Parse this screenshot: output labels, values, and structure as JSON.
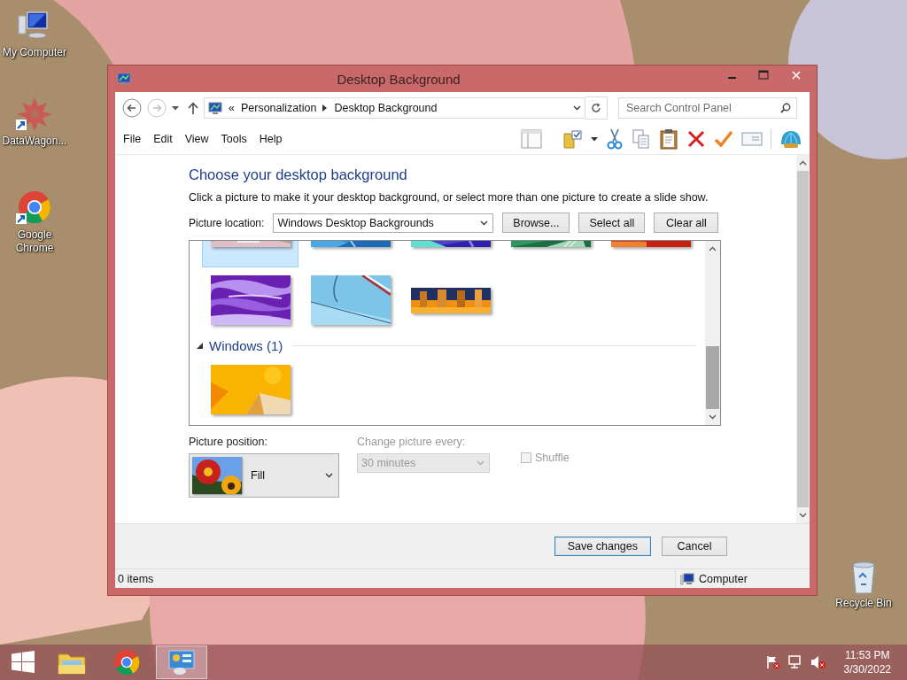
{
  "desktop": {
    "wallpaper": {
      "kind": "picture"
    },
    "icons": [
      {
        "label": "My Computer",
        "kind": "computer",
        "shortcut": false
      },
      {
        "label": "DataWagon...",
        "kind": "datawagon",
        "shortcut": true
      },
      {
        "label": "Google Chrome",
        "kind": "chrome",
        "shortcut": true
      },
      {
        "label": "Recycle Bin",
        "kind": "recycle",
        "shortcut": false
      }
    ]
  },
  "window": {
    "title": "Desktop Background",
    "address_bar": {
      "overflow": "«",
      "path": [
        "Personalization",
        "Desktop Background"
      ]
    },
    "search": {
      "placeholder": "Search Control Panel"
    },
    "menu": [
      "File",
      "Edit",
      "View",
      "Tools",
      "Help"
    ],
    "content": {
      "heading": "Choose your desktop background",
      "description": "Click a picture to make it your desktop background, or select more than one picture to create a slide show.",
      "picture_location": {
        "label": "Picture location:",
        "value": "Windows Desktop Backgrounds"
      },
      "buttons": [
        "Browse...",
        "Select all",
        "Clear all"
      ],
      "gallery": {
        "thumbnails": [
          {
            "kind": "picture",
            "selected": true
          },
          {
            "kind": "picture",
            "selected": false
          },
          {
            "kind": "picture",
            "selected": false
          },
          {
            "kind": "picture",
            "selected": false
          },
          {
            "kind": "picture",
            "selected": false
          },
          {
            "kind": "picture",
            "selected": false
          },
          {
            "kind": "picture",
            "selected": false
          },
          {
            "kind": "picture",
            "selected": false
          }
        ],
        "groups": [
          {
            "label": "Windows (1)",
            "expanded": true,
            "thumbnails": [
              {
                "kind": "picture",
                "selected": false
              }
            ]
          }
        ]
      },
      "picture_position": {
        "label": "Picture position:",
        "value": "Fill"
      },
      "change_picture": {
        "label": "Change picture every:",
        "value": "30 minutes",
        "disabled": true
      },
      "shuffle": {
        "label": "Shuffle",
        "checked": false,
        "disabled": true
      }
    },
    "footer_buttons": [
      {
        "label": "Save changes",
        "default": true
      },
      {
        "label": "Cancel",
        "default": false
      }
    ],
    "status_bar": {
      "items": "0 items",
      "location": "Computer"
    }
  },
  "taskbar": {
    "apps": [
      {
        "kind": "explorer",
        "active": false
      },
      {
        "kind": "chrome",
        "active": false
      },
      {
        "kind": "control_panel",
        "active": true
      }
    ],
    "time": "11:53 PM",
    "date": "3/30/2022"
  }
}
